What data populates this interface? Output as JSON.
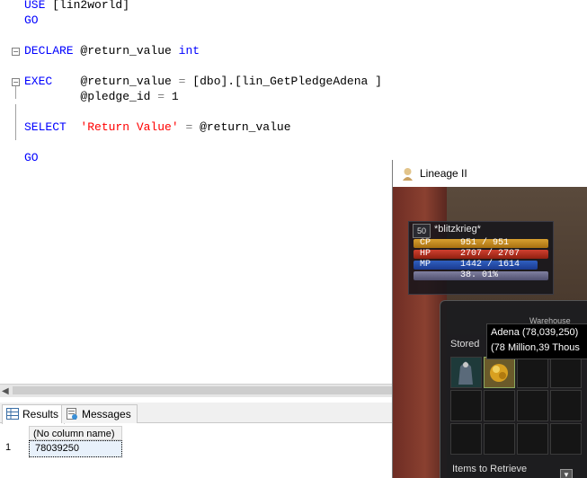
{
  "editor": {
    "lines": {
      "use_kw": "USE",
      "use_db": "[lin2world]",
      "go1": "GO",
      "declare_kw": "DECLARE",
      "declare_var": "@return_value",
      "declare_type": "int",
      "exec_kw": "EXEC",
      "exec_var": "@return_value",
      "exec_eq": "=",
      "exec_proc": "[dbo].[lin_GetPledgeAdena ]",
      "param_var": "@pledge_id",
      "param_eq": "=",
      "param_val": "1",
      "select_kw": "SELECT",
      "select_str": "'Return Value'",
      "select_eq": "=",
      "select_var": "@return_value",
      "go2": "GO"
    }
  },
  "results": {
    "tabs": [
      {
        "label": "Results",
        "icon": "grid-icon"
      },
      {
        "label": "Messages",
        "icon": "messages-icon"
      }
    ],
    "column_header": "(No column name)",
    "row_number": "1",
    "cell_value": "78039250"
  },
  "game": {
    "window_title": "Lineage II",
    "player": {
      "level": "50",
      "name": "*blitzkrieg*",
      "cp_label": "CP",
      "cp_value": "951 / 951",
      "hp_label": "HP",
      "hp_value": "2707 / 2707",
      "mp_label": "MP",
      "mp_value": "1442 / 1614",
      "xp_value": "38. 01%",
      "mp_fill": 0.893
    },
    "warehouse": {
      "title": "Warehouse",
      "stored_label": "Stored",
      "tooltip_line1": "Adena (78,039,250)",
      "tooltip_line2": "(78  Million,39 Thous",
      "items_to_retrieve": "Items to Retrieve"
    }
  }
}
